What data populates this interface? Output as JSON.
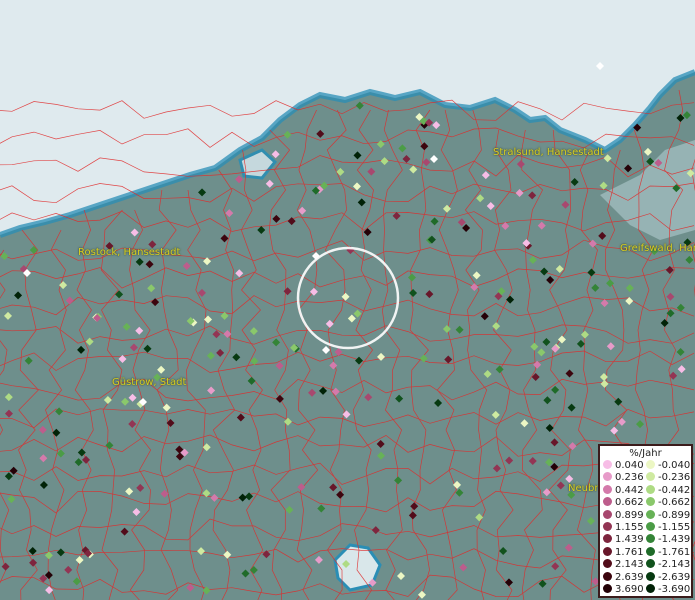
{
  "map": {
    "colors": {
      "sea": "#dfeaee",
      "land": "#6e8f8c",
      "coast": "#2a8eb5",
      "boundary": "#e02a2a",
      "label": "#d8cf22"
    },
    "cities": [
      {
        "label": "Rostock, Hansestadt"
      },
      {
        "label": "Stralsund, Hansestadt"
      },
      {
        "label": "Greifswald, Han"
      },
      {
        "label": "Güstrow, Stadt"
      },
      {
        "label": "Neubr"
      }
    ],
    "highlight": {
      "shape": "circle",
      "color": "#ffffff"
    }
  },
  "legend": {
    "title": "%/Jahr",
    "positive": [
      {
        "label": "0.040",
        "color": "#f7bde6"
      },
      {
        "label": "0.236",
        "color": "#e79bc9"
      },
      {
        "label": "0.442",
        "color": "#d47aab"
      },
      {
        "label": "0.662",
        "color": "#bd5d8c"
      },
      {
        "label": "0.899",
        "color": "#a8486f"
      },
      {
        "label": "1.155",
        "color": "#933554"
      },
      {
        "label": "1.439",
        "color": "#7e253e"
      },
      {
        "label": "1.761",
        "color": "#68172a"
      },
      {
        "label": "2.143",
        "color": "#520c1a"
      },
      {
        "label": "2.639",
        "color": "#3c050e"
      },
      {
        "label": "3.690",
        "color": "#240107"
      }
    ],
    "negative": [
      {
        "label": "-0.040",
        "color": "#ecf7c4"
      },
      {
        "label": "-0.236",
        "color": "#cfeaa1"
      },
      {
        "label": "-0.442",
        "color": "#aedb84"
      },
      {
        "label": "-0.662",
        "color": "#8ac86b"
      },
      {
        "label": "-0.899",
        "color": "#67b257"
      },
      {
        "label": "-1.155",
        "color": "#4b9c46"
      },
      {
        "label": "-1.439",
        "color": "#348437"
      },
      {
        "label": "-1.761",
        "color": "#1f6b29"
      },
      {
        "label": "-2.143",
        "color": "#11521d"
      },
      {
        "label": "-2.639",
        "color": "#073a11"
      },
      {
        "label": "-3.690",
        "color": "#012207"
      }
    ]
  }
}
